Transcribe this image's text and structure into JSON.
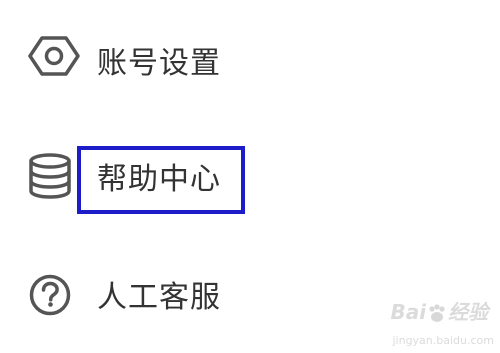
{
  "menu": {
    "items": [
      {
        "label": "账号设置",
        "icon": "gear-icon"
      },
      {
        "label": "帮助中心",
        "icon": "database-icon",
        "highlighted": true
      },
      {
        "label": "人工客服",
        "icon": "question-icon"
      }
    ]
  },
  "colors": {
    "text": "#333333",
    "icon": "#555555",
    "highlight_border": "#1c1cc8"
  },
  "watermark": {
    "brand": "Bai",
    "brand_suffix": "经验",
    "sub": "jingyan.baidu.com"
  }
}
